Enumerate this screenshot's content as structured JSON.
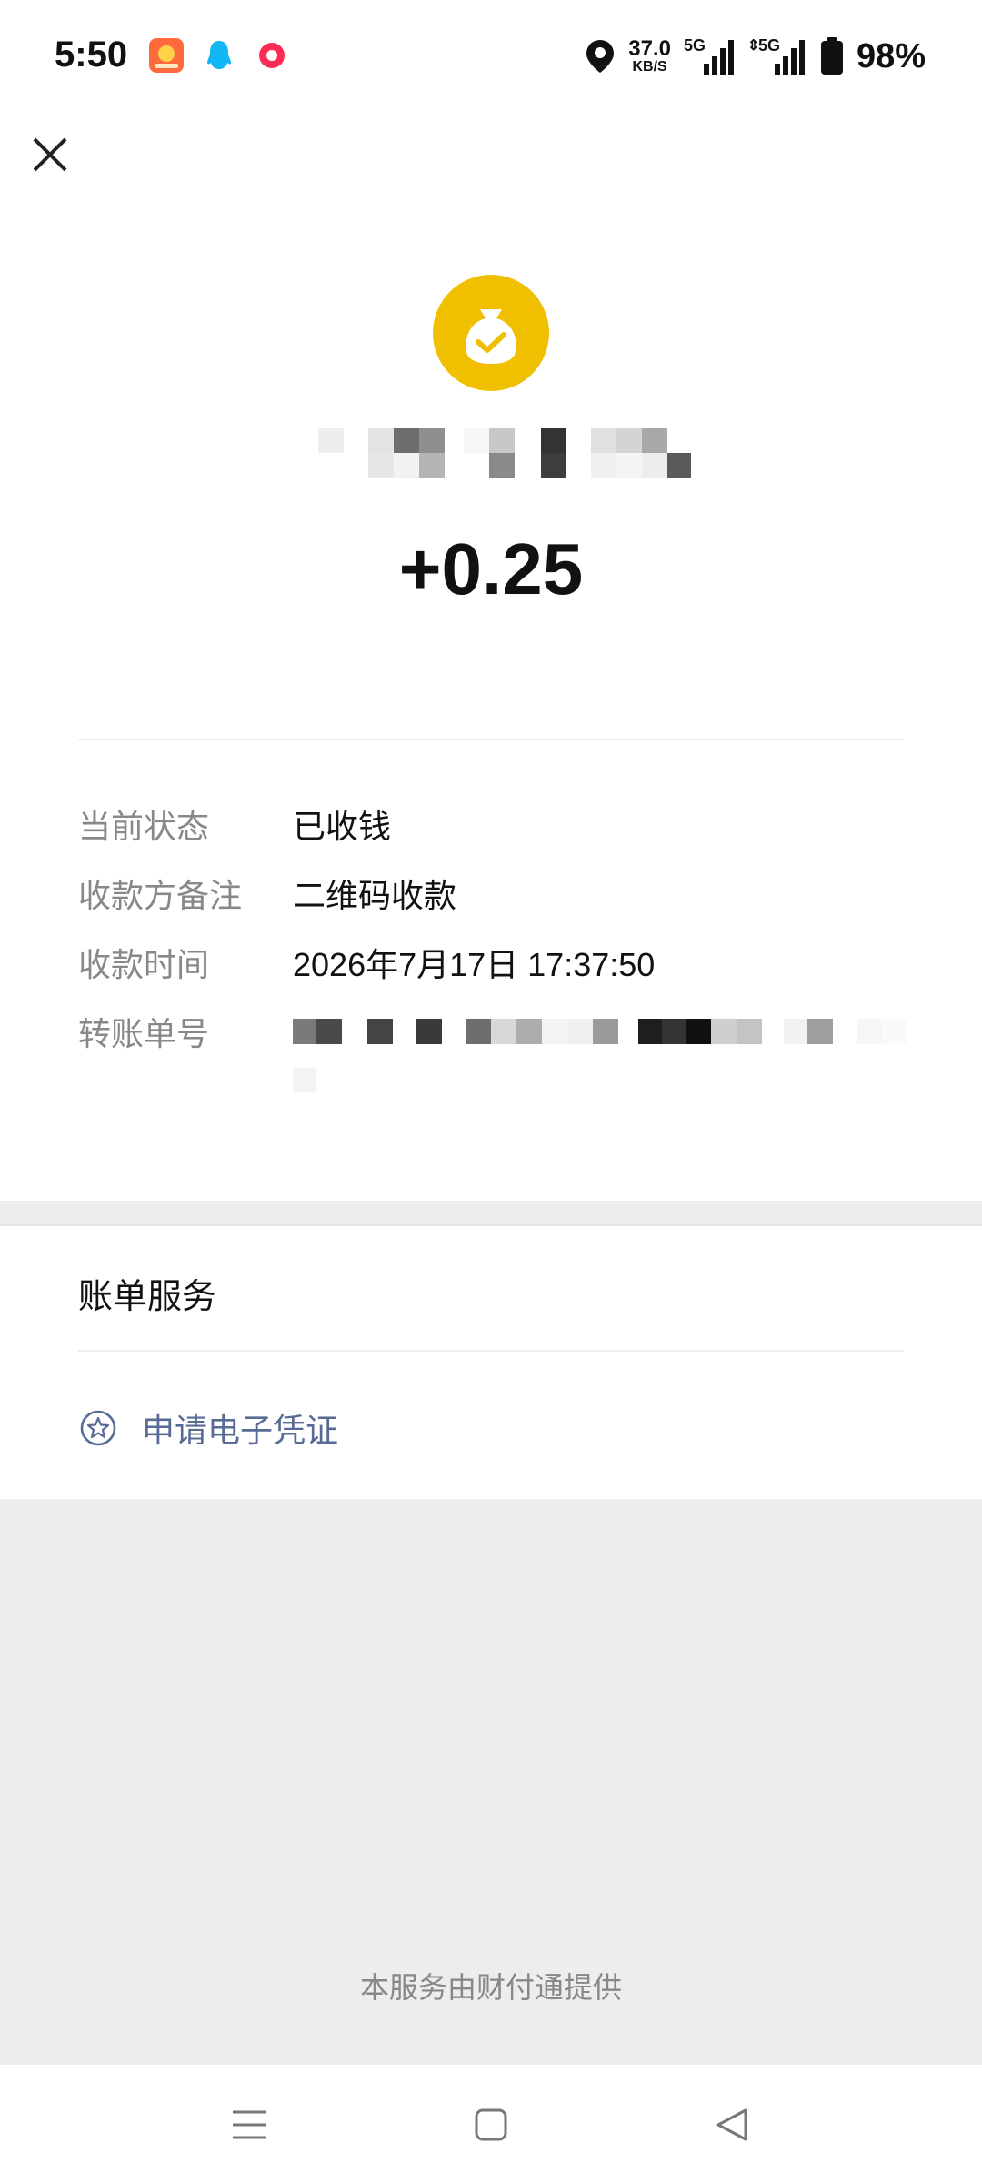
{
  "status_bar": {
    "time": "5:50",
    "net_speed_value": "37.0",
    "net_speed_unit": "KB/S",
    "signal_1_label": "5G",
    "signal_2_label": "5G",
    "battery": "98%"
  },
  "transaction": {
    "amount": "+0.25",
    "details": [
      {
        "label": "当前状态",
        "value": "已收钱"
      },
      {
        "label": "收款方备注",
        "value": "二维码收款"
      },
      {
        "label": "收款时间",
        "value": "2026年7月17日 17:37:50"
      },
      {
        "label": "转账单号",
        "value": ""
      }
    ]
  },
  "bill_service": {
    "title": "账单服务",
    "voucher_label": "申请电子凭证"
  },
  "footer": {
    "provider_text": "本服务由财付通提供"
  },
  "colors": {
    "accent_gold": "#f0c000",
    "link_blue": "#576b95",
    "background_gray": "#ededed"
  },
  "icons": {
    "close": "close-icon",
    "money_bag": "money-bag-icon",
    "voucher": "star-circle-icon",
    "nav_menu": "menu-icon",
    "nav_home": "home-square-icon",
    "nav_back": "back-triangle-icon"
  }
}
